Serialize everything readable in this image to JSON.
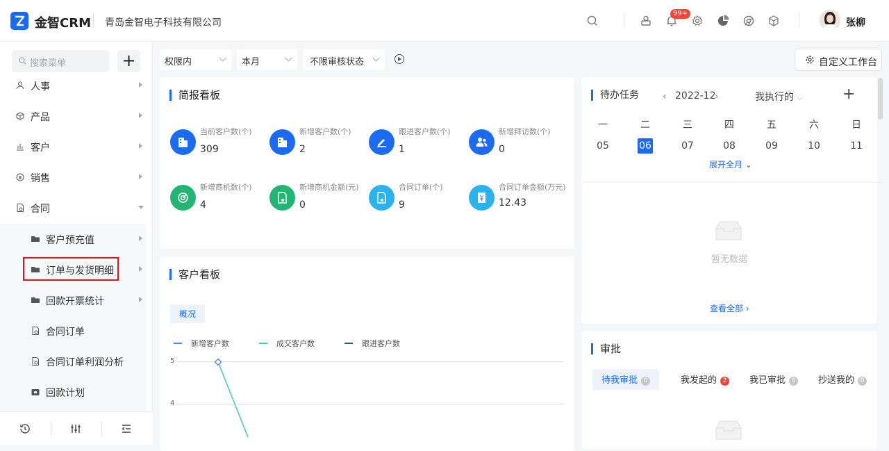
{
  "header": {
    "logo_text": "金智CRM",
    "company": "青岛金智电子科技有限公司",
    "notif_badge": "99+",
    "user_name": "张柳",
    "icons": [
      "search-icon",
      "message-icon",
      "bell-icon",
      "gear-icon",
      "pie-chart-icon",
      "chrome-icon",
      "cube-icon"
    ]
  },
  "sidebar": {
    "search_placeholder": "搜索菜单",
    "add_label": "+",
    "items": [
      {
        "label": "人事",
        "icon": "people-icon",
        "expanded": false
      },
      {
        "label": "产品",
        "icon": "box-icon",
        "expanded": false
      },
      {
        "label": "客户",
        "icon": "chart-icon",
        "expanded": false
      },
      {
        "label": "销售",
        "icon": "sales-icon",
        "expanded": false
      },
      {
        "label": "合同",
        "icon": "contract-icon",
        "expanded": true
      }
    ],
    "sub_items": [
      {
        "label": "客户预充值",
        "icon": "folder-icon",
        "has_arrow": true
      },
      {
        "label": "订单与发货明细",
        "icon": "folder-icon",
        "has_arrow": true,
        "highlighted": true
      },
      {
        "label": "回款开票统计",
        "icon": "folder-icon",
        "has_arrow": true
      },
      {
        "label": "合同订单",
        "icon": "doc-icon",
        "has_arrow": false
      },
      {
        "label": "合同订单利润分析",
        "icon": "doc-icon",
        "has_arrow": false
      },
      {
        "label": "回款计划",
        "icon": "calendar-icon",
        "has_arrow": false
      }
    ],
    "footer_icons": [
      "history-icon",
      "filter-sliders-icon",
      "collapse-menu-icon"
    ]
  },
  "filters": {
    "scope": "权限内",
    "period": "本月",
    "audit": "不限审核状态",
    "custom_workspace": "自定义工作台"
  },
  "briefing": {
    "title": "简报看板",
    "stats": [
      {
        "label": "当前客户数(个)",
        "value": "309",
        "color": "#1a6af4"
      },
      {
        "label": "新增客户数(个)",
        "value": "2",
        "color": "#1a6af4"
      },
      {
        "label": "跟进客户数(个)",
        "value": "1",
        "color": "#1a6af4"
      },
      {
        "label": "新增拜访数(个)",
        "value": "0",
        "color": "#1a6af4"
      },
      {
        "label": "新增商机数(个)",
        "value": "4",
        "color": "#22b573"
      },
      {
        "label": "新增商机金额(元)",
        "value": "0",
        "color": "#22b573"
      },
      {
        "label": "合同订单(个)",
        "value": "9",
        "color": "#2bb3ef"
      },
      {
        "label": "合同订单金额(万元)",
        "value": "12.43",
        "color": "#2bb3ef"
      }
    ]
  },
  "customer_board": {
    "title": "客户看板",
    "tab": "概况",
    "legend": [
      {
        "name": "新增客户数",
        "color": "#4f86f7"
      },
      {
        "name": "成交客户数",
        "color": "#45d1ad"
      },
      {
        "name": "跟进客户数",
        "color": "#3a4f7a"
      }
    ],
    "y_ticks": [
      "5",
      "4"
    ]
  },
  "chart_data": {
    "type": "line",
    "series": [
      {
        "name": "新增客户数",
        "values": [
          5
        ]
      },
      {
        "name": "成交客户数",
        "values": [
          5,
          3.2
        ]
      }
    ],
    "ylim": [
      0,
      5
    ]
  },
  "todo": {
    "title": "待办任务",
    "prev": "‹",
    "next": "›",
    "month": "2022-12",
    "owner_filter": "我执行的",
    "add": "+",
    "weekdays": [
      "一",
      "二",
      "三",
      "四",
      "五",
      "六",
      "日"
    ],
    "days": [
      "05",
      "06",
      "07",
      "08",
      "09",
      "10",
      "11"
    ],
    "selected_day": "06",
    "expand": "展开全月",
    "empty": "暂无数据",
    "view_all": "查看全部"
  },
  "approval": {
    "title": "审批",
    "tabs": [
      {
        "label": "待我审批",
        "count": "0",
        "active": true
      },
      {
        "label": "我发起的",
        "count": "2",
        "active": false
      },
      {
        "label": "我已审批",
        "count": "0",
        "active": false
      },
      {
        "label": "抄送我的",
        "count": "0",
        "active": false
      }
    ]
  }
}
